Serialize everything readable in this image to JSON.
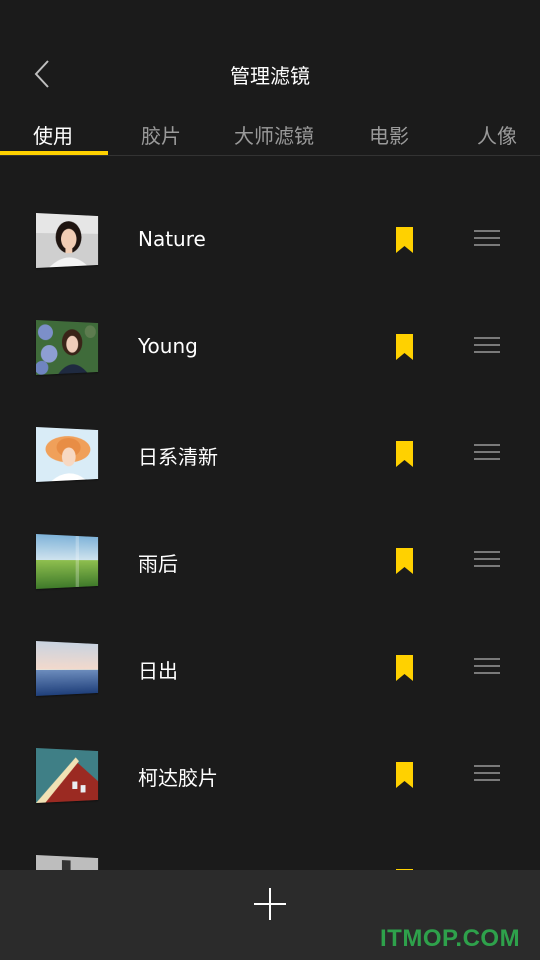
{
  "header": {
    "title": "管理滤镜",
    "back_icon": "chevron-left-icon"
  },
  "tabs": [
    {
      "label": "使用",
      "active": true
    },
    {
      "label": "胶片",
      "active": false
    },
    {
      "label": "大师滤镜",
      "active": false
    },
    {
      "label": "电影",
      "active": false
    },
    {
      "label": "人像",
      "active": false
    }
  ],
  "filters": [
    {
      "name": "Nature",
      "thumb": "portrait-woman-icon",
      "bookmarked": true
    },
    {
      "name": "Young",
      "thumb": "portrait-flowers-icon",
      "bookmarked": true
    },
    {
      "name": "日系清新",
      "thumb": "portrait-hat-icon",
      "bookmarked": true
    },
    {
      "name": "雨后",
      "thumb": "grass-field-icon",
      "bookmarked": true
    },
    {
      "name": "日出",
      "thumb": "sea-horizon-icon",
      "bookmarked": true
    },
    {
      "name": "柯达胶片",
      "thumb": "red-house-icon",
      "bookmarked": true
    }
  ],
  "bottom_bar": {
    "add_icon": "plus-icon"
  },
  "watermark": "ITMOP.COM",
  "colors": {
    "background": "#1b1b1b",
    "accent": "#ffd100",
    "bottom_bar": "#2b2b2b",
    "watermark": "#2ea14b"
  }
}
